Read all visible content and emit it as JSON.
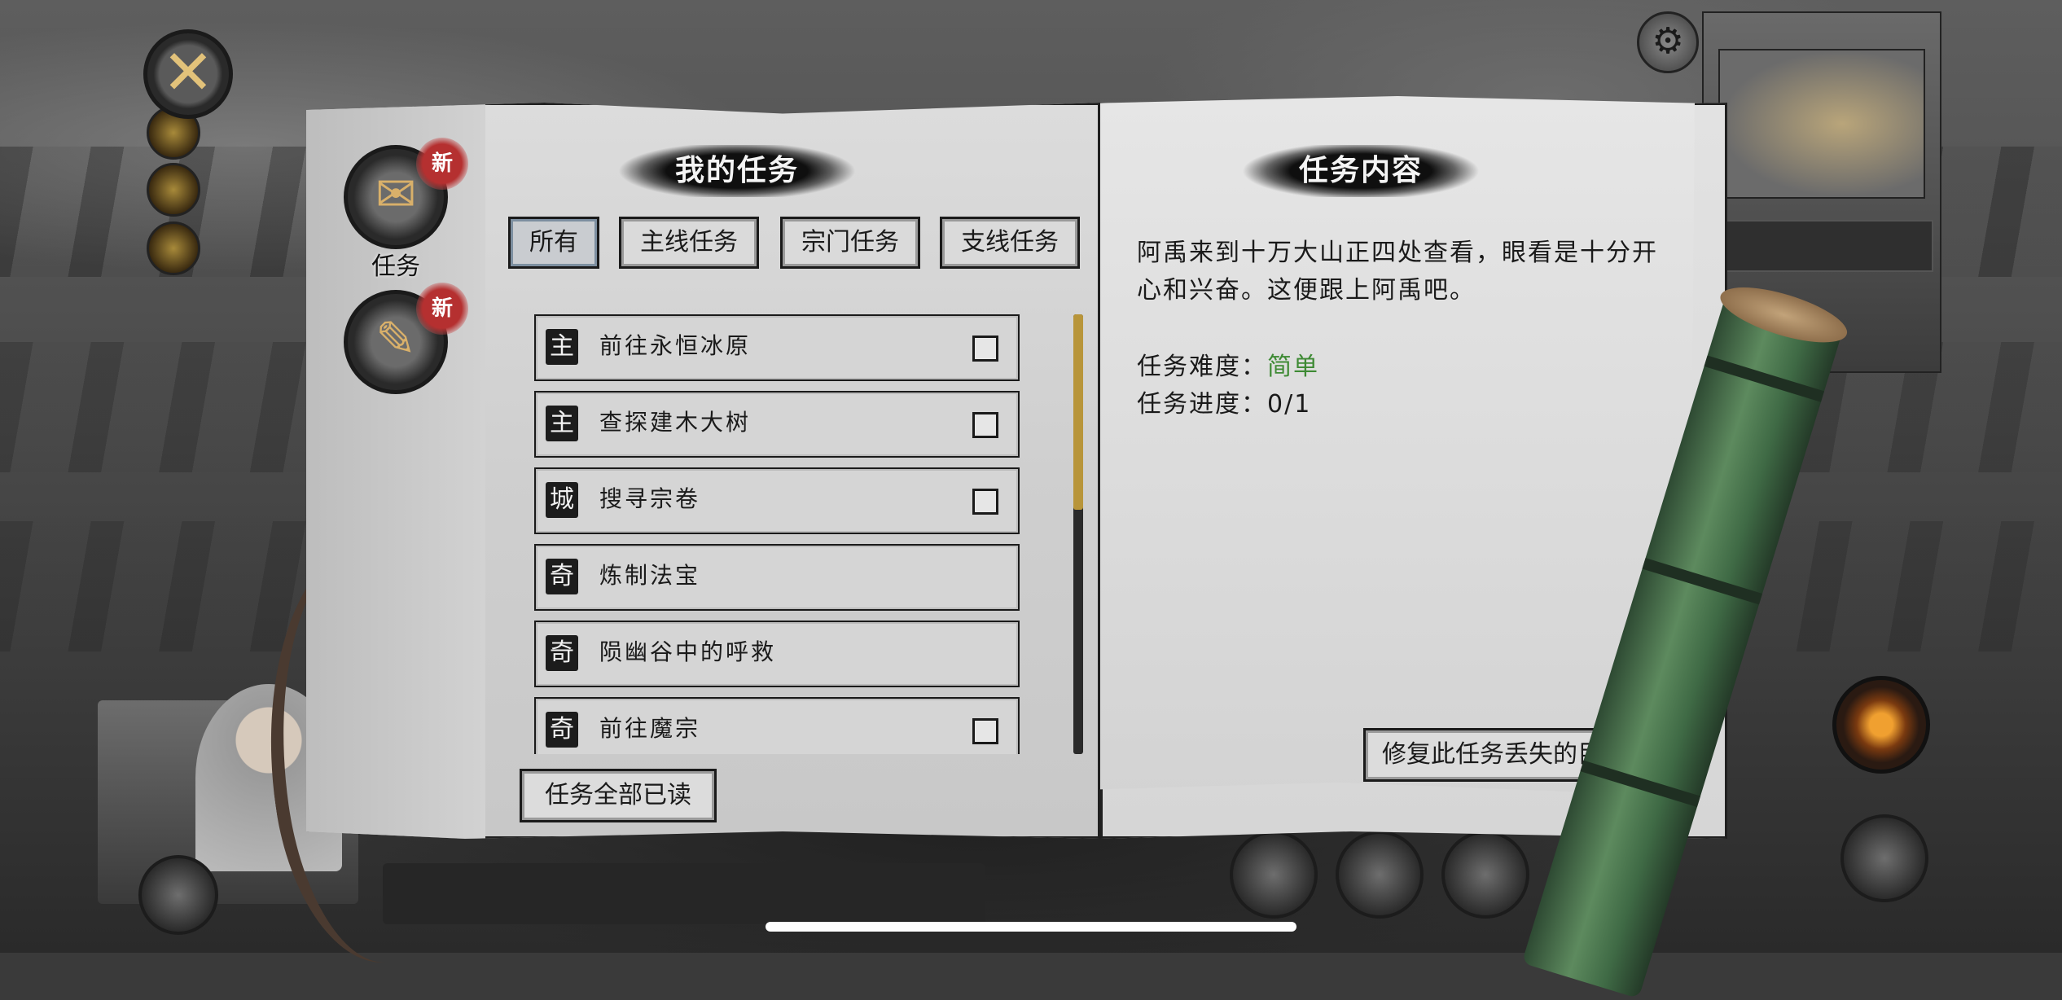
{
  "book": {
    "left_title": "我的任务",
    "right_title": "任务内容",
    "side_tabs": [
      {
        "label": "任务",
        "badge": "新",
        "icon": "scroll-icon"
      },
      {
        "badge": "新",
        "icon": "letter-icon"
      }
    ],
    "filters": [
      "所有",
      "主线任务",
      "宗门任务",
      "支线任务"
    ],
    "active_filter": "所有",
    "quests": [
      {
        "tag": "主",
        "name": "前往永恒冰原",
        "checkbox": true
      },
      {
        "tag": "主",
        "name": "查探建木大树",
        "checkbox": true
      },
      {
        "tag": "城",
        "name": "搜寻宗卷",
        "checkbox": true
      },
      {
        "tag": "奇",
        "name": "炼制法宝",
        "checkbox": false
      },
      {
        "tag": "奇",
        "name": "陨幽谷中的呼救",
        "checkbox": false
      },
      {
        "tag": "奇",
        "name": "前往魔宗",
        "checkbox": true
      }
    ],
    "read_all_label": "任务全部已读",
    "detail": {
      "description": "阿禹来到十万大山正四处查看，眼看是十分开心和兴奋。这便跟上阿禹吧。",
      "difficulty_label": "任务难度：",
      "difficulty_value": "简单",
      "progress_label": "任务进度：",
      "progress_value": "0/1",
      "fix_label": "修复此任务丢失的目标"
    }
  },
  "colors": {
    "difficulty_easy": "#3e8a34",
    "scroll_thumb": "#b8953a",
    "badge": "#b53030"
  }
}
